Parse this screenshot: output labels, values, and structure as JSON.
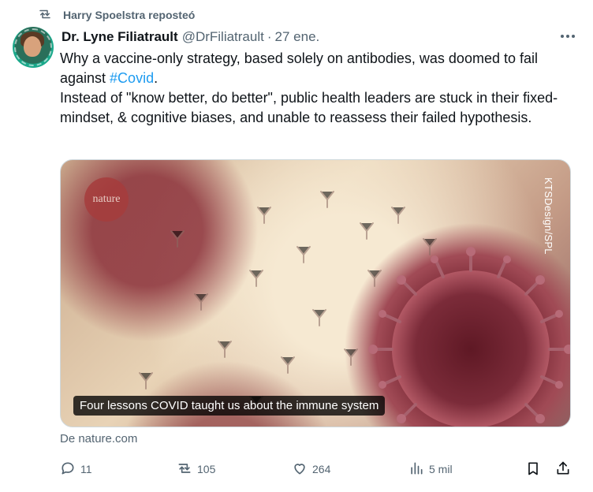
{
  "repost": {
    "label": "Harry Spoelstra reposteó"
  },
  "author": {
    "name": "Dr. Lyne Filiatrault",
    "handle": "@DrFiliatrault",
    "separator": "·",
    "date": "27 ene."
  },
  "tweet": {
    "line1": "Why a vaccine-only strategy, based solely on antibodies, was doomed to fail against ",
    "hashtag": "#Covid",
    "line1_end": ".",
    "line2": "Instead of \"know better, do better\", public health leaders are stuck in their fixed-mindset, & cognitive biases, and unable to reassess their failed hypothesis."
  },
  "card": {
    "logo": "nature",
    "credit": "KTSDesign/SPL",
    "caption": "Four lessons COVID taught us about the immune system"
  },
  "source": {
    "label": "De nature.com"
  },
  "actions": {
    "replies": "11",
    "reposts": "105",
    "likes": "264",
    "views": "5 mil"
  },
  "icons": {
    "repost": "repost-icon",
    "reply": "reply-icon",
    "like": "heart-icon",
    "views": "views-icon",
    "bookmark": "bookmark-icon",
    "share": "share-icon",
    "more": "more-icon"
  },
  "colors": {
    "accent": "#1d9bf0",
    "muted": "#536471",
    "text": "#0f1419"
  }
}
